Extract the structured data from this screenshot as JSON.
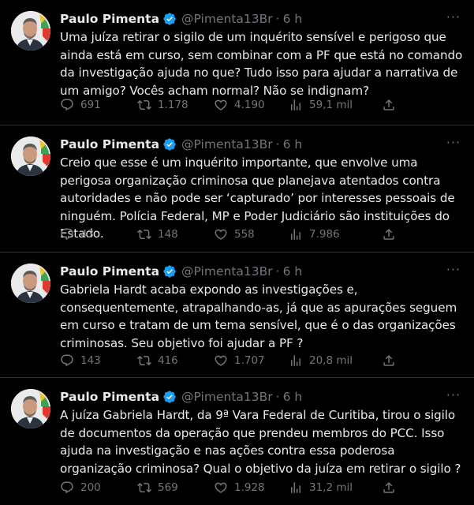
{
  "colors": {
    "background": "#000000",
    "text": "#e7e9ea",
    "secondary": "#71767b",
    "verified": "#1d9bf0",
    "divider": "#2f3336"
  },
  "tweets": [
    {
      "author_name": "Paulo Pimenta",
      "handle": "@Pimenta13Br",
      "separator": "·",
      "time": "6 h",
      "more": "···",
      "text": "Uma juíza retirar o sigilo de um inquérito sensível e perigoso que ainda está em curso, sem combinar com a PF que está no comando da investigação ajuda no que? Tudo isso para ajudar a narrativa de um amigo? Vocês acham normal? Não se indignam?",
      "replies": "691",
      "reposts": "1.178",
      "likes": "4.190",
      "views": "59,1 mil"
    },
    {
      "author_name": "Paulo Pimenta",
      "handle": "@Pimenta13Br",
      "separator": "·",
      "time": "6 h",
      "more": "···",
      "text": "Creio que esse é um inquérito importante, que envolve uma perigosa organização criminosa que planejava atentados contra autoridades e não pode ser ‘capturado’ por interesses pessoais de ninguém. Polícia Federal, MP e Poder Judiciário são instituições do Estado.",
      "replies": "43",
      "reposts": "148",
      "likes": "558",
      "views": "7.986"
    },
    {
      "author_name": "Paulo Pimenta",
      "handle": "@Pimenta13Br",
      "separator": "·",
      "time": "6 h",
      "more": "···",
      "text": "Gabriela Hardt acaba expondo as investigações e, consequentemente, atrapalhando-as, já que as apurações seguem em curso e tratam de um tema sensível, que é o das organizações criminosas. Seu objetivo foi ajudar a PF ?",
      "replies": "143",
      "reposts": "416",
      "likes": "1.707",
      "views": "20,8 mil"
    },
    {
      "author_name": "Paulo Pimenta",
      "handle": "@Pimenta13Br",
      "separator": "·",
      "time": "6 h",
      "more": "···",
      "text": "A juíza Gabriela Hardt, da 9ª Vara Federal de Curitiba, tirou o sigilo de documentos da operação que prendeu membros do PCC. Isso ajuda na investigação e nas ações contra essa poderosa organização criminosa? Qual o objetivo da juíza em retirar o sigilo ?",
      "replies": "200",
      "reposts": "569",
      "likes": "1.928",
      "views": "31,2 mil"
    }
  ]
}
